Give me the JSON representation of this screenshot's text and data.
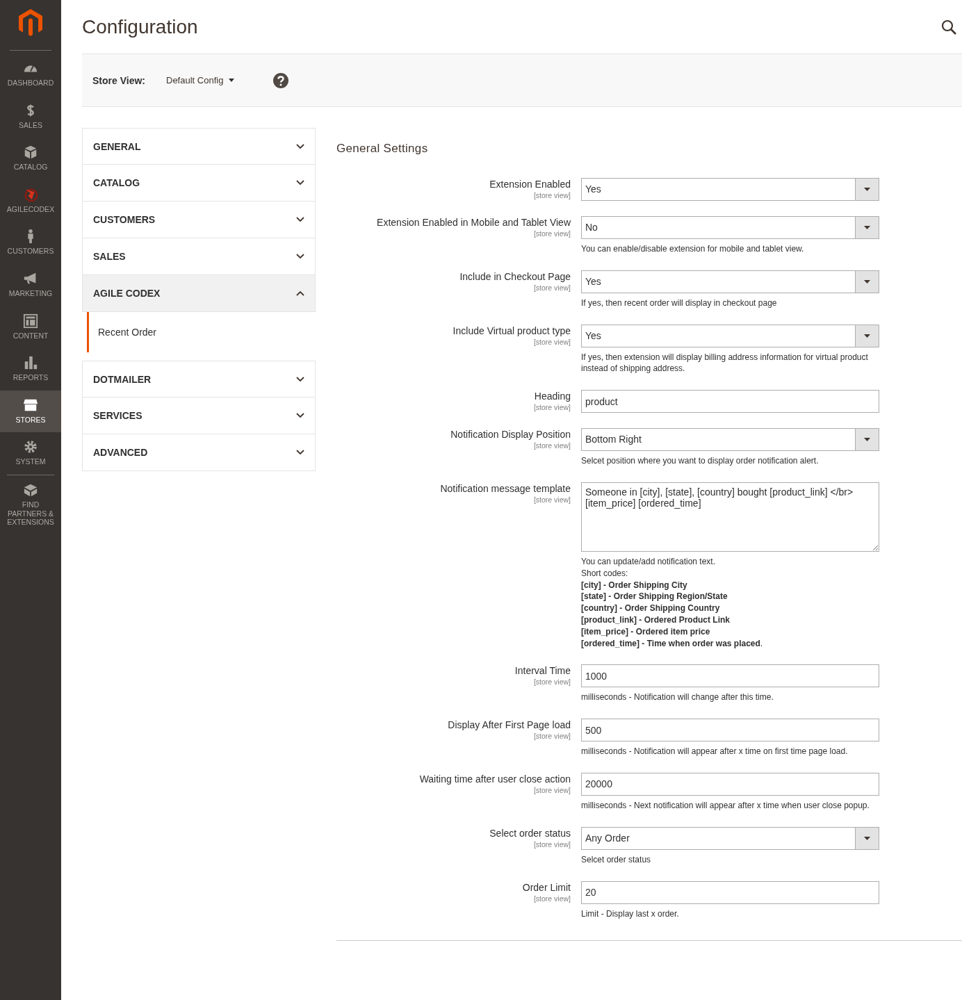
{
  "nav": [
    {
      "label": "DASHBOARD",
      "selected": false
    },
    {
      "label": "SALES",
      "selected": false
    },
    {
      "label": "CATALOG",
      "selected": false
    },
    {
      "label": "AGILECODEX",
      "selected": false
    },
    {
      "label": "CUSTOMERS",
      "selected": false
    },
    {
      "label": "MARKETING",
      "selected": false
    },
    {
      "label": "CONTENT",
      "selected": false
    },
    {
      "label": "REPORTS",
      "selected": false
    },
    {
      "label": "STORES",
      "selected": true
    },
    {
      "label": "SYSTEM",
      "selected": false
    },
    {
      "label": "FIND PARTNERS & EXTENSIONS",
      "selected": false
    }
  ],
  "page_title": "Configuration",
  "store_view": {
    "label": "Store View:",
    "value": "Default Config"
  },
  "tabs": [
    {
      "label": "GENERAL",
      "expanded": false
    },
    {
      "label": "CATALOG",
      "expanded": false
    },
    {
      "label": "CUSTOMERS",
      "expanded": false
    },
    {
      "label": "SALES",
      "expanded": false
    },
    {
      "label": "AGILE CODEX",
      "expanded": true,
      "children": [
        {
          "label": "Recent Order",
          "selected": true
        }
      ]
    },
    {
      "label": "DOTMAILER",
      "expanded": false
    },
    {
      "label": "SERVICES",
      "expanded": false
    },
    {
      "label": "ADVANCED",
      "expanded": false
    }
  ],
  "section_title": "General Settings",
  "fields": [
    {
      "kind": "select",
      "label": "Extension Enabled",
      "scope": "[store view]",
      "value": "Yes"
    },
    {
      "kind": "select",
      "label": "Extension Enabled in Mobile and Tablet View",
      "scope": "[store view]",
      "value": "No",
      "note": "You can enable/disable extension for mobile and tablet view."
    },
    {
      "kind": "select",
      "label": "Include in Checkout Page",
      "scope": "[store view]",
      "value": "Yes",
      "note": "If yes, then recent order will display in checkout page"
    },
    {
      "kind": "select",
      "label": "Include Virtual product type",
      "scope": "[store view]",
      "value": "Yes",
      "note": "If yes, then extension will display billing address information for virtual product instead of shipping address."
    },
    {
      "kind": "text",
      "label": "Heading",
      "scope": "[store view]",
      "value": "product"
    },
    {
      "kind": "select",
      "label": "Notification Display Position",
      "scope": "[store view]",
      "value": "Bottom Right",
      "note": "Selcet position where you want to display order notification alert."
    },
    {
      "kind": "textarea",
      "label": "Notification message template",
      "scope": "[store view]",
      "value": "Someone in [city], [state], [country] bought [product_link] </br>\n[item_price] [ordered_time]",
      "note": "You can update/add notification text.\nShort codes:\n**[city] - Order Shipping City**\n**[state] - Order Shipping Region/State**\n**[country] - Order Shipping Country**\n**[product_link] - Ordered Product Link**\n**[item_price] - Ordered item price**\n**[ordered_time] - Time when order was placed**."
    },
    {
      "kind": "text",
      "label": "Interval Time",
      "scope": "[store view]",
      "value": "1000",
      "note": "milliseconds - Notification will change after this time."
    },
    {
      "kind": "text",
      "label": "Display After First Page load",
      "scope": "[store view]",
      "value": "500",
      "note": "milliseconds - Notification will appear after x time on first time page load."
    },
    {
      "kind": "text",
      "label": "Waiting time after user close action",
      "scope": "[store view]",
      "value": "20000",
      "note": "milliseconds - Next notification will appear after x time when user close popup."
    },
    {
      "kind": "select",
      "label": "Select order status",
      "scope": "[store view]",
      "value": "Any Order",
      "note": "Selcet order status"
    },
    {
      "kind": "text",
      "label": "Order Limit",
      "scope": "[store view]",
      "value": "20",
      "note": "Limit - Display last x order."
    }
  ]
}
